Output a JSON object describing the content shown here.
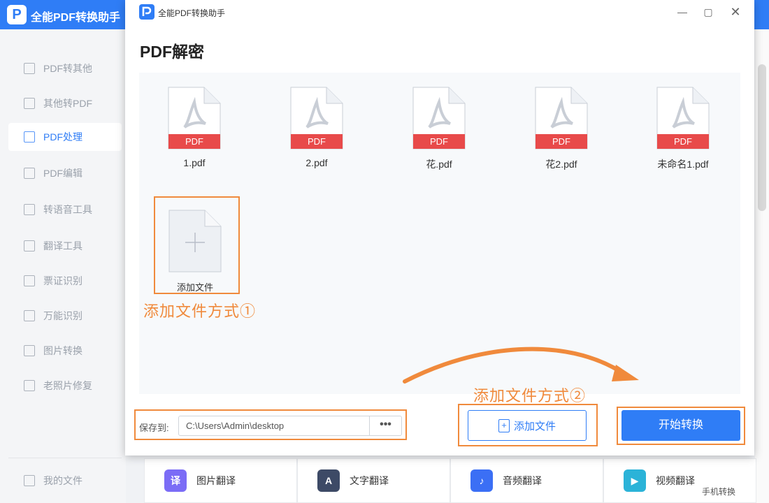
{
  "app": {
    "title": "全能PDF转换助手",
    "logo_letter": "P"
  },
  "sidebar": {
    "items": [
      {
        "label": "PDF转其他",
        "icon": "pdf-convert-icon"
      },
      {
        "label": "其他转PDF",
        "icon": "to-pdf-icon"
      },
      {
        "label": "PDF处理",
        "icon": "pdf-process-icon",
        "active": true
      },
      {
        "label": "PDF编辑",
        "icon": "pdf-edit-icon"
      },
      {
        "label": "转语音工具",
        "icon": "voice-icon"
      },
      {
        "label": "翻译工具",
        "icon": "translate-icon"
      },
      {
        "label": "票证识别",
        "icon": "ticket-icon"
      },
      {
        "label": "万能识别",
        "icon": "ocr-icon"
      },
      {
        "label": "图片转换",
        "icon": "image-convert-icon"
      },
      {
        "label": "老照片修复",
        "icon": "photo-repair-icon"
      }
    ],
    "my_files": "我的文件"
  },
  "bottom_tools": [
    {
      "label": "图片翻译",
      "icon": "image-translate-icon",
      "color": "#7b6cf6"
    },
    {
      "label": "文字翻译",
      "icon": "text-translate-icon",
      "color": "#3d4a66"
    },
    {
      "label": "音频翻译",
      "icon": "audio-translate-icon",
      "color": "#3b6ff5"
    },
    {
      "label": "视频翻译",
      "icon": "video-translate-icon",
      "color": "#2bb3d8"
    }
  ],
  "mobile_convert": "手机转换",
  "dialog": {
    "title": "全能PDF转换助手",
    "page_title": "PDF解密",
    "files": [
      {
        "name": "1.pdf",
        "badge": "PDF"
      },
      {
        "name": "2.pdf",
        "badge": "PDF"
      },
      {
        "name": "花.pdf",
        "badge": "PDF"
      },
      {
        "name": "花2.pdf",
        "badge": "PDF"
      },
      {
        "name": "未命名1.pdf",
        "badge": "PDF"
      }
    ],
    "add_tile_label": "添加文件",
    "annotation_1": "添加文件方式①",
    "annotation_2": "添加文件方式②",
    "save_label": "保存到:",
    "save_path": "C:\\Users\\Admin\\desktop",
    "browse_button": "•••",
    "add_file_button": "添加文件",
    "start_button": "开始转换"
  },
  "colors": {
    "accent": "#2f7df6",
    "annotation": "#f08a3c",
    "pdf_badge": "#e84a4a"
  }
}
